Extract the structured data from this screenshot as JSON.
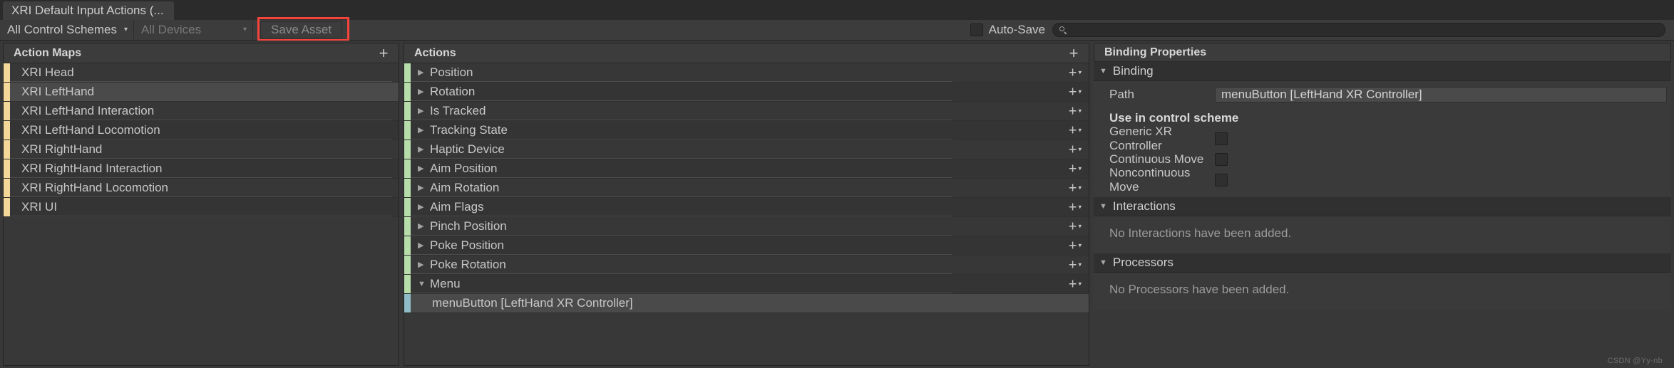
{
  "window": {
    "tab_title": "XRI Default Input Actions (...",
    "watermark": "CSDN @Yy-nb"
  },
  "toolbar": {
    "control_schemes_label": "All Control Schemes",
    "devices_label": "All Devices",
    "save_asset_label": "Save Asset",
    "autosave_label": "Auto-Save",
    "search_value": "",
    "search_placeholder": "",
    "highlight_color": "#f4433a"
  },
  "action_maps": {
    "header": "Action Maps",
    "add_label": "+",
    "items": [
      {
        "label": "XRI Head",
        "selected": false
      },
      {
        "label": "XRI LeftHand",
        "selected": true
      },
      {
        "label": "XRI LeftHand Interaction",
        "selected": false
      },
      {
        "label": "XRI LeftHand Locomotion",
        "selected": false
      },
      {
        "label": "XRI RightHand",
        "selected": false
      },
      {
        "label": "XRI RightHand Interaction",
        "selected": false
      },
      {
        "label": "XRI RightHand Locomotion",
        "selected": false
      },
      {
        "label": "XRI UI",
        "selected": false
      }
    ],
    "accent_color": "#f3d89a"
  },
  "actions": {
    "header": "Actions",
    "add_label": "+",
    "accent_color": "#b6ddaa",
    "binding_accent_color": "#8fbcc6",
    "items": [
      {
        "label": "Position",
        "type": "action",
        "expanded": false,
        "selected": false
      },
      {
        "label": "Rotation",
        "type": "action",
        "expanded": false,
        "selected": false
      },
      {
        "label": "Is Tracked",
        "type": "action",
        "expanded": false,
        "selected": false
      },
      {
        "label": "Tracking State",
        "type": "action",
        "expanded": false,
        "selected": false
      },
      {
        "label": "Haptic Device",
        "type": "action",
        "expanded": false,
        "selected": false
      },
      {
        "label": "Aim Position",
        "type": "action",
        "expanded": false,
        "selected": false
      },
      {
        "label": "Aim Rotation",
        "type": "action",
        "expanded": false,
        "selected": false
      },
      {
        "label": "Aim Flags",
        "type": "action",
        "expanded": false,
        "selected": false
      },
      {
        "label": "Pinch Position",
        "type": "action",
        "expanded": false,
        "selected": false
      },
      {
        "label": "Poke Position",
        "type": "action",
        "expanded": false,
        "selected": false
      },
      {
        "label": "Poke Rotation",
        "type": "action",
        "expanded": false,
        "selected": false
      },
      {
        "label": "Menu",
        "type": "action",
        "expanded": true,
        "selected": false
      },
      {
        "label": "menuButton [LeftHand XR Controller]",
        "type": "binding",
        "expanded": false,
        "selected": true
      }
    ]
  },
  "binding_properties": {
    "header": "Binding Properties",
    "binding_section": {
      "title": "Binding",
      "path_label": "Path",
      "path_value": "menuButton [LeftHand XR Controller]",
      "control_scheme_title": "Use in control scheme",
      "schemes": [
        {
          "label": "Generic XR Controller",
          "checked": false
        },
        {
          "label": "Continuous Move",
          "checked": false
        },
        {
          "label": "Noncontinuous Move",
          "checked": false
        }
      ]
    },
    "interactions_section": {
      "title": "Interactions",
      "empty_text": "No Interactions have been added."
    },
    "processors_section": {
      "title": "Processors",
      "empty_text": "No Processors have been added."
    }
  },
  "icons": {
    "caret_down": "▾",
    "triangle_right": "▶",
    "triangle_down": "▼",
    "plus": "+"
  }
}
